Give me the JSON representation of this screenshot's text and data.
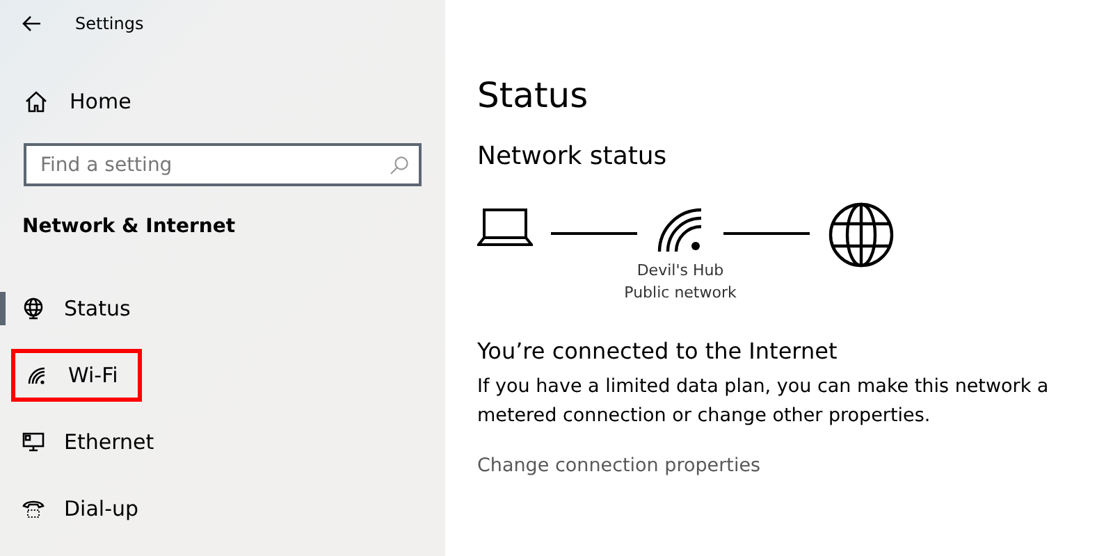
{
  "window": {
    "title": "Settings"
  },
  "sidebar": {
    "home": "Home",
    "search": {
      "placeholder": "Find a setting"
    },
    "section": "Network & Internet",
    "items": [
      {
        "label": "Status",
        "kind": "globe",
        "selected": true,
        "highlighted": false
      },
      {
        "label": "Wi-Fi",
        "kind": "wifi",
        "selected": false,
        "highlighted": true
      },
      {
        "label": "Ethernet",
        "kind": "ethernet",
        "selected": false,
        "highlighted": false
      },
      {
        "label": "Dial-up",
        "kind": "phone",
        "selected": false,
        "highlighted": false
      }
    ]
  },
  "main": {
    "title": "Status",
    "subtitle": "Network status",
    "network_name": "Devil's Hub",
    "network_type": "Public network",
    "connection_heading": "You’re connected to the Internet",
    "description": "If you have a limited data plan, you can make this network a metered connection or change other properties.",
    "link": "Change connection properties"
  }
}
